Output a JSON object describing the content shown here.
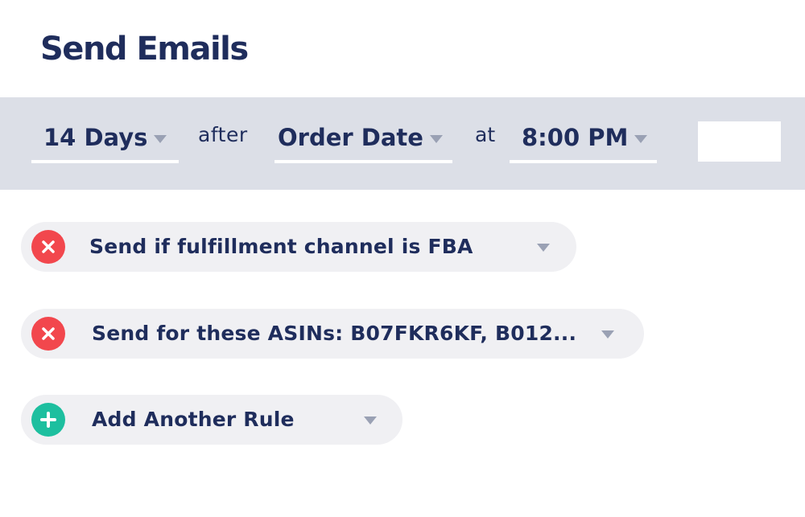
{
  "title": "Send Emails",
  "schedule": {
    "days": "14 Days",
    "after_word": "after",
    "anchor": "Order Date",
    "at_word": "at",
    "time": "8:00 PM"
  },
  "rules": [
    {
      "label": "Send if fulfillment channel is FBA",
      "action_icon": "remove-x-icon",
      "color": "#f2474d"
    },
    {
      "label": "Send for these ASINs: B07FKR6KF, B012...",
      "action_icon": "remove-x-icon",
      "color": "#f2474d"
    },
    {
      "label": "Add Another Rule",
      "action_icon": "add-plus-icon",
      "color": "#1dbf9f"
    }
  ],
  "colors": {
    "text": "#1f2d5c",
    "bar_background": "#dcdfe7",
    "rule_background": "#f0f0f3",
    "caret": "#9aa1b4"
  }
}
